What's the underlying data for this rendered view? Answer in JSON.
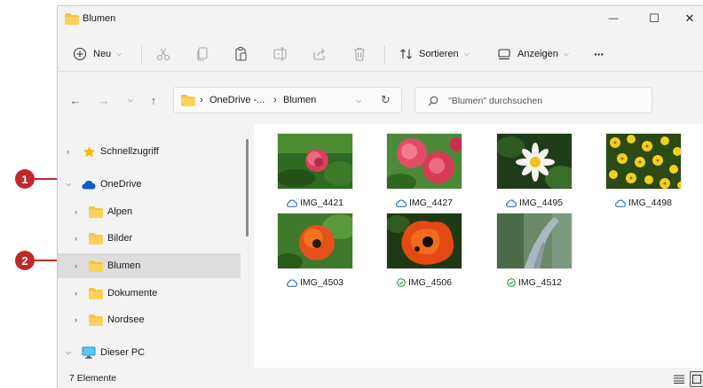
{
  "window": {
    "title": "Blumen",
    "minimize_glyph": "—",
    "maximize_glyph": "☐",
    "close_glyph": "✕"
  },
  "commandbar": {
    "new_label": "Neu",
    "sort_label": "Sortieren",
    "view_label": "Anzeigen",
    "more_label": "···"
  },
  "address": {
    "segments": [
      "OneDrive -...",
      "Blumen"
    ],
    "search_placeholder": "\"Blumen\" durchsuchen"
  },
  "navpane": {
    "items": [
      {
        "label": "Schnellzugriff",
        "icon": "star-icon",
        "expanded": false
      },
      {
        "label": "OneDrive",
        "icon": "cloud-icon",
        "expanded": true
      },
      {
        "label": "Alpen",
        "icon": "folder-icon",
        "expanded": false
      },
      {
        "label": "Bilder",
        "icon": "folder-icon",
        "expanded": false
      },
      {
        "label": "Blumen",
        "icon": "folder-icon",
        "expanded": false,
        "selected": true
      },
      {
        "label": "Dokumente",
        "icon": "folder-icon",
        "expanded": false
      },
      {
        "label": "Nordsee",
        "icon": "folder-icon",
        "expanded": false
      },
      {
        "label": "Dieser PC",
        "icon": "monitor-icon",
        "expanded": true
      }
    ]
  },
  "files": [
    {
      "name": "IMG_4421",
      "status": "cloud-icon"
    },
    {
      "name": "IMG_4427",
      "status": "cloud-icon"
    },
    {
      "name": "IMG_4495",
      "status": "cloud-icon"
    },
    {
      "name": "IMG_4498",
      "status": "cloud-icon"
    },
    {
      "name": "IMG_4503",
      "status": "cloud-icon"
    },
    {
      "name": "IMG_4506",
      "status": "synced-check-icon"
    },
    {
      "name": "IMG_4512",
      "status": "synced-check-icon"
    }
  ],
  "status": {
    "item_count": "7 Elemente"
  },
  "callouts": [
    "1",
    "2"
  ],
  "colors": {
    "accent": "#0067c0",
    "callout": "#c0282a",
    "folder": "#f6c544",
    "synced": "#1e8a3a"
  }
}
